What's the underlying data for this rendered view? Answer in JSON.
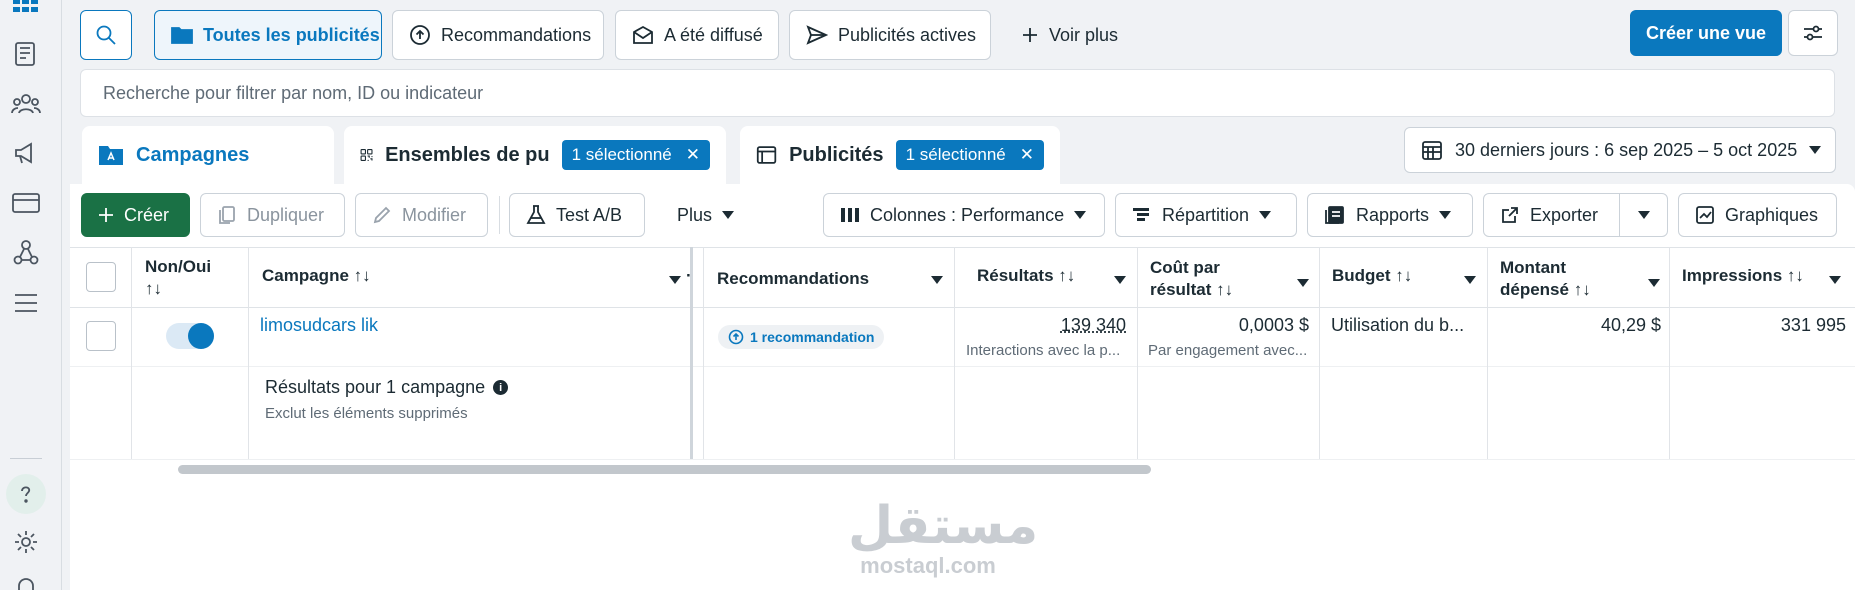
{
  "toolbar": {
    "views": [
      {
        "label": "Toutes les publicités"
      },
      {
        "label": "Recommandations"
      },
      {
        "label": "A été diffusé"
      },
      {
        "label": "Publicités actives"
      }
    ],
    "more_label": "Voir plus",
    "create_view_label": "Créer une vue"
  },
  "search": {
    "placeholder": "Recherche pour filtrer par nom, ID ou indicateur"
  },
  "tabs": {
    "campaigns": "Campagnes",
    "adsets": "Ensembles de pu",
    "adsets_chip": "1 sélectionné",
    "ads": "Publicités",
    "ads_chip": "1 sélectionné"
  },
  "date_range": "30 derniers jours : 6 sep 2025 – 5 oct 2025",
  "actions": {
    "create": "Créer",
    "duplicate": "Dupliquer",
    "edit": "Modifier",
    "ab_test": "Test A/B",
    "more": "Plus",
    "columns": "Colonnes : Performance",
    "breakdown": "Répartition",
    "reports": "Rapports",
    "export": "Exporter",
    "charts": "Graphiques"
  },
  "table": {
    "headers": {
      "toggle": [
        "Non/Oui",
        "↑↓"
      ],
      "campaign": "Campagne ↑↓",
      "recommendations": "Recommandations",
      "results": "Résultats ↑↓",
      "cost_per_result": [
        "Coût par",
        "résultat ↑↓"
      ],
      "budget": "Budget ↑↓",
      "amount_spent": [
        "Montant",
        "dépensé ↑↓"
      ],
      "impressions": "Impressions ↑↓"
    },
    "row": {
      "campaign_name": "limosudcars lik",
      "recommendation": "1 recommandation",
      "results": "139 340",
      "results_sub": "Interactions avec la p...",
      "cost_per_result": "0,0003 $",
      "cost_sub": "Par engagement avec...",
      "budget": "Utilisation du b...",
      "amount_spent": "40,29 $",
      "impressions": "331 995",
      "toggle_on": true
    },
    "summary": {
      "title": "Résultats pour 1 campagne",
      "subtitle": "Exclut les éléments supprimés"
    }
  },
  "watermark": {
    "arabic": "مستقل",
    "latin": "mostaql.com"
  },
  "colors": {
    "accent": "#0a78be",
    "create_green": "#1a7145"
  }
}
